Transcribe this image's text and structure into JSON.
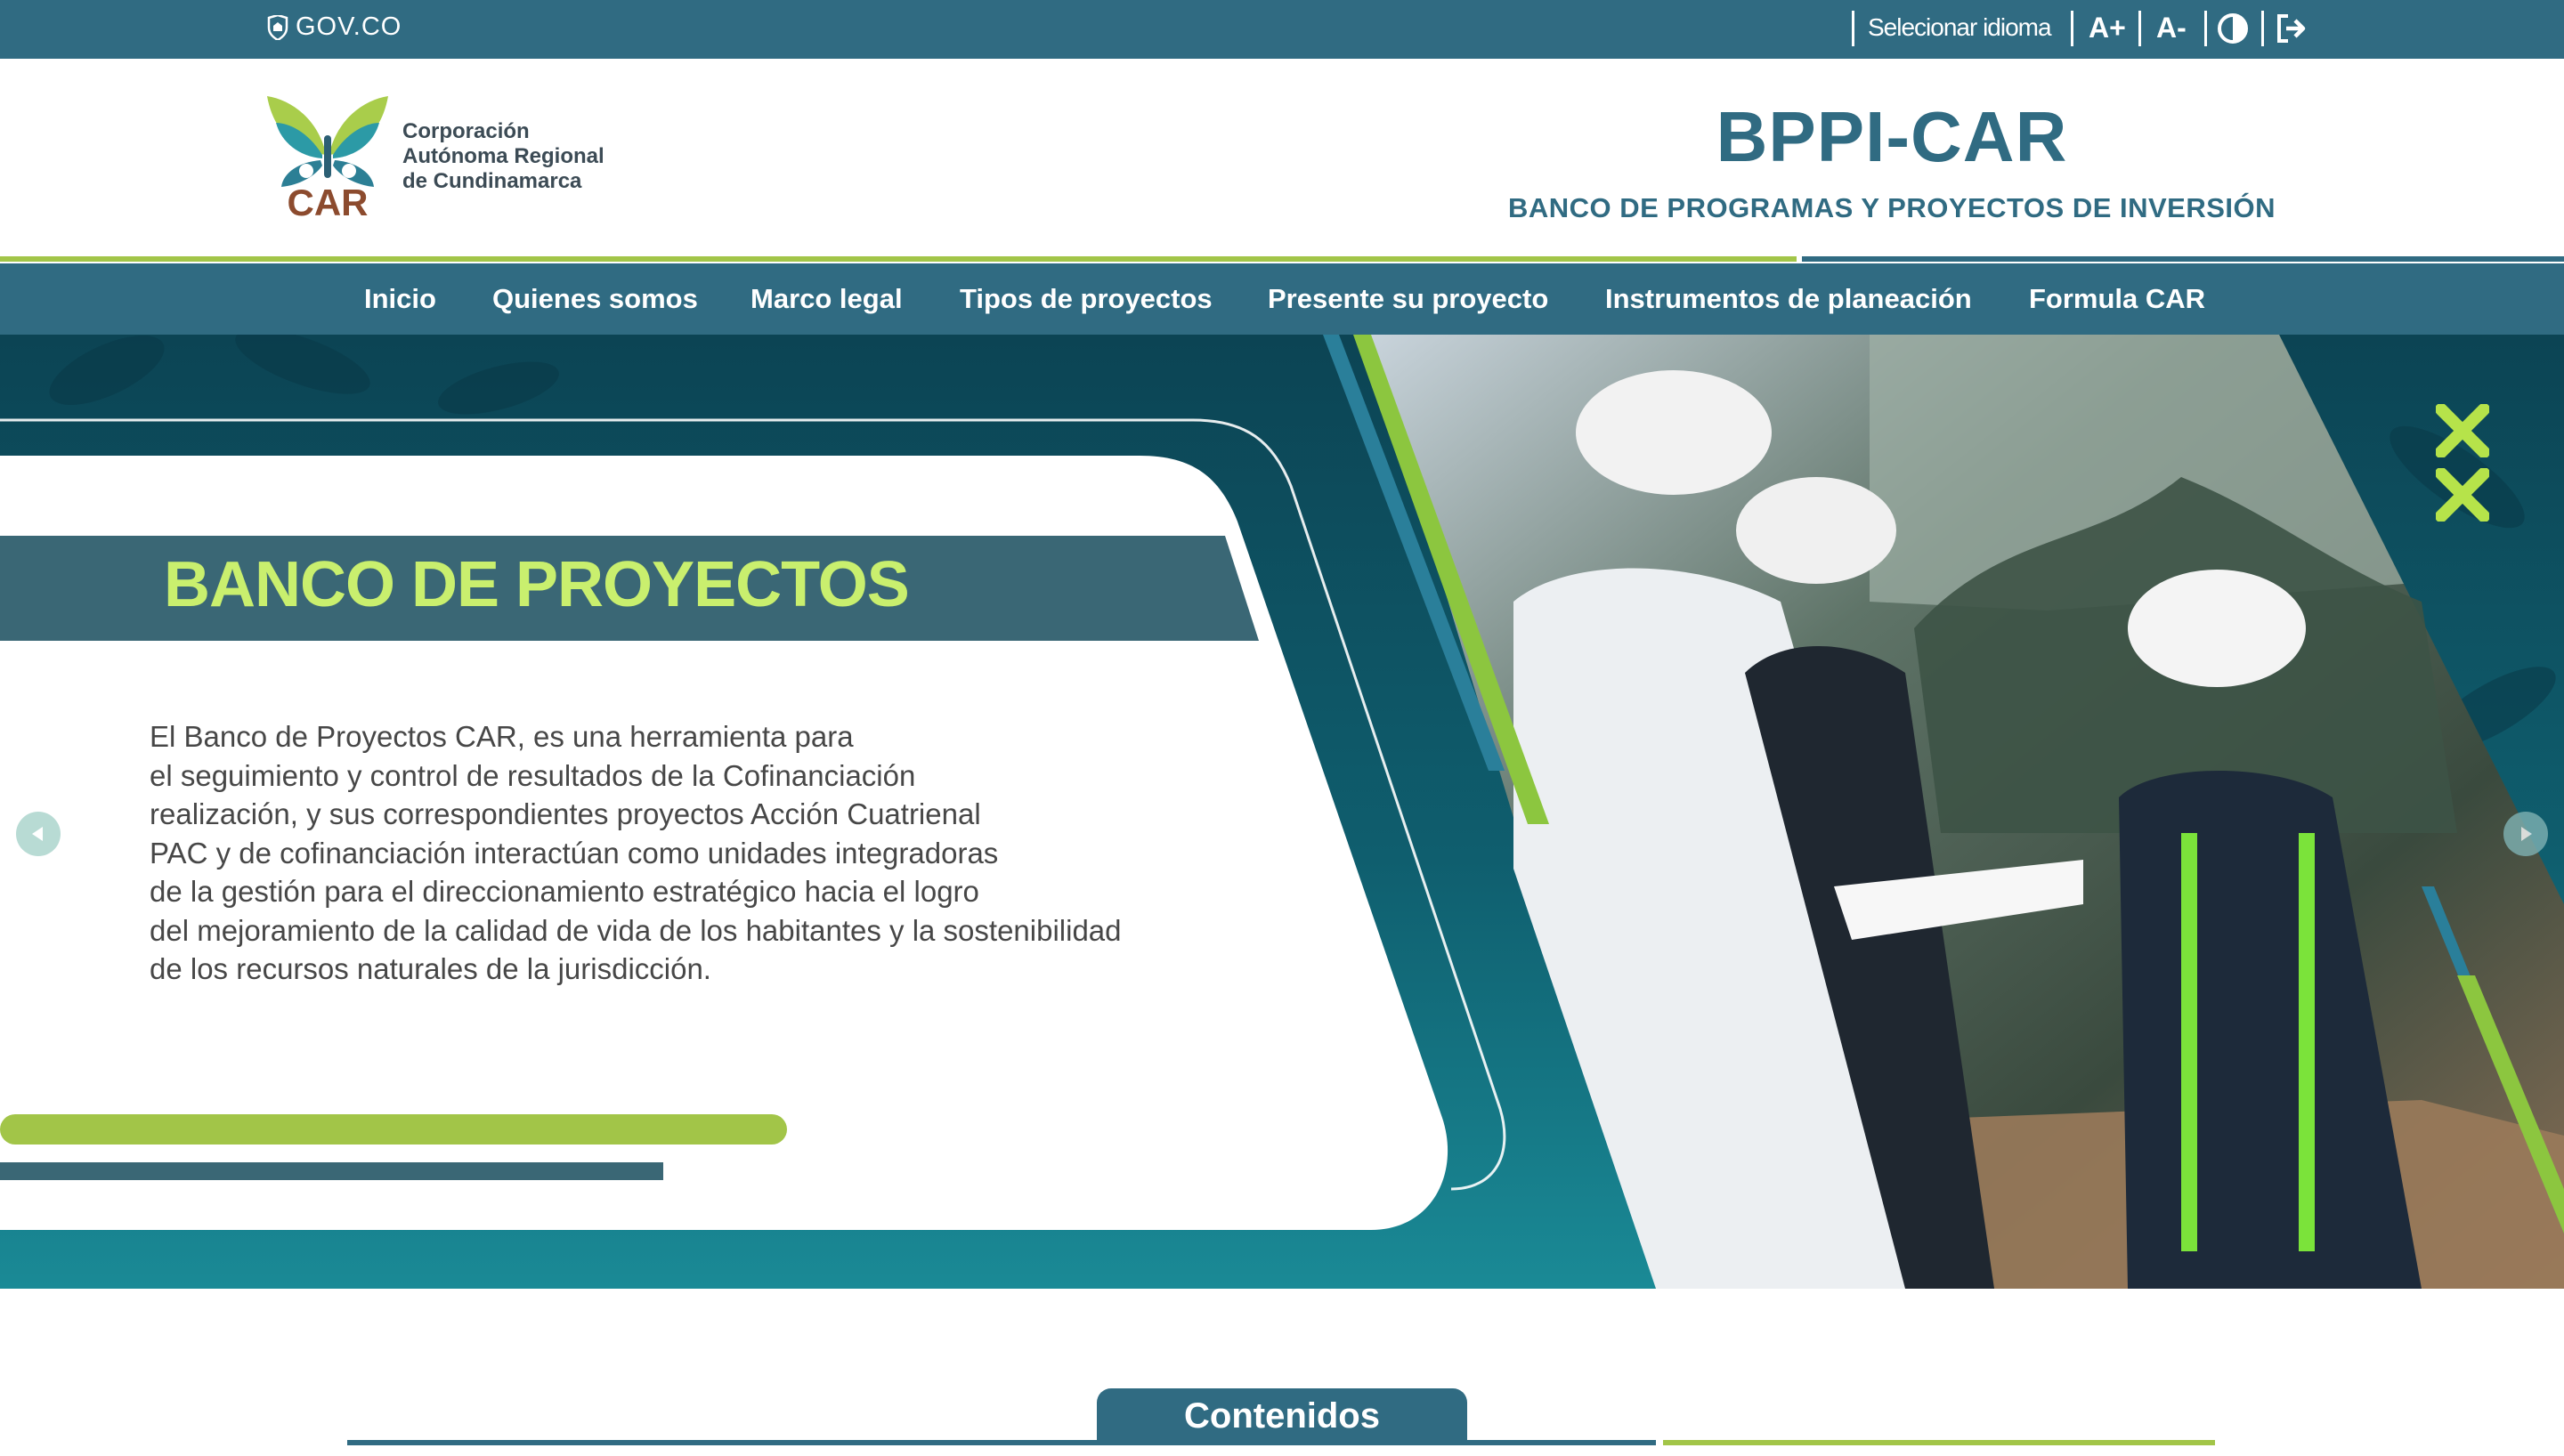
{
  "govbar": {
    "logo_text": "GOV.CO",
    "language_label": "Selecionar idioma",
    "font_increase": "A+",
    "font_decrease": "A-",
    "contrast_icon": "contrast-icon",
    "login_icon": "sign-in-icon"
  },
  "header": {
    "org_line1": "Corporación",
    "org_line2": "Autónoma Regional",
    "org_line3": "de Cundinamarca",
    "logo_text": "CAR",
    "title": "BPPI-CAR",
    "subtitle": "BANCO DE PROGRAMAS Y PROYECTOS DE INVERSIÓN"
  },
  "nav": {
    "items": [
      {
        "label": "Inicio"
      },
      {
        "label": "Quienes somos"
      },
      {
        "label": "Marco legal"
      },
      {
        "label": "Tipos de proyectos"
      },
      {
        "label": "Presente su proyecto"
      },
      {
        "label": "Instrumentos de planeación"
      },
      {
        "label": "Formula CAR"
      }
    ]
  },
  "hero": {
    "title": "BANCO DE PROYECTOS",
    "lines": [
      "El Banco de Proyectos CAR, es una herramienta para",
      "el seguimiento y control de resultados de la Cofinanciación",
      "realización, y sus correspondientes proyectos Acción Cuatrienal",
      "PAC y de cofinanciación interactúan como unidades integradoras",
      "de la gestión para el direccionamiento estratégico hacia el logro",
      "del mejoramiento de la calidad de vida de los habitantes y la sostenibilidad",
      "de los recursos naturales de la jurisdicción."
    ],
    "prev_icon": "chevron-left-icon",
    "next_icon": "chevron-right-icon"
  },
  "contents": {
    "label": "Contenidos"
  },
  "colors": {
    "primary": "#306b82",
    "accent_green": "#a2c548",
    "hero_title": "#c9ef6e"
  }
}
